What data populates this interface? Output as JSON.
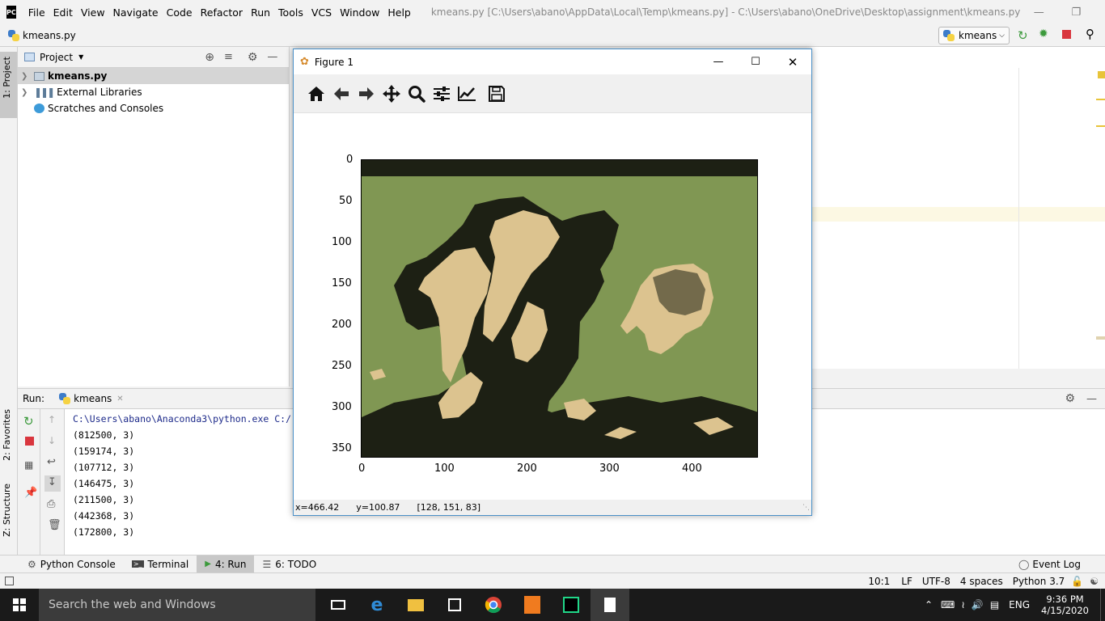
{
  "app": {
    "logo_text": "PC",
    "menu": [
      "File",
      "Edit",
      "View",
      "Navigate",
      "Code",
      "Refactor",
      "Run",
      "Tools",
      "VCS",
      "Window",
      "Help"
    ],
    "window_title": "kmeans.py [C:\\Users\\abano\\AppData\\Local\\Temp\\kmeans.py] - C:\\Users\\abano\\OneDrive\\Desktop\\assignment\\kmeans.py"
  },
  "navbar": {
    "file": "kmeans.py",
    "run_config": "kmeans"
  },
  "left_stripe": {
    "project_tab": "1: Project",
    "favorites_tab": "2: Favorites",
    "structure_tab": "Z: Structure"
  },
  "project": {
    "header": "Project",
    "items": [
      {
        "label": "kmeans.py"
      },
      {
        "label": "External Libraries"
      },
      {
        "label": "Scratches and Consoles"
      }
    ]
  },
  "run_panel": {
    "label": "Run:",
    "tab": "kmeans",
    "lines": [
      "C:\\Users\\abano\\Anaconda3\\python.exe C:/",
      "(812500, 3)",
      "(159174, 3)",
      "(107712, 3)",
      "(146475, 3)",
      "(211500, 3)",
      "(442368, 3)",
      "(172800, 3)"
    ]
  },
  "bottom_tabs": {
    "python_console": "Python Console",
    "terminal": "Terminal",
    "run": "4: Run",
    "todo": "6: TODO",
    "event_log": "Event Log"
  },
  "status": {
    "position": "10:1",
    "line_sep": "LF",
    "encoding": "UTF-8",
    "indent": "4 spaces",
    "interpreter": "Python 3.7"
  },
  "taskbar": {
    "search": "Search the web and Windows",
    "lang": "ENG",
    "time": "9:36 PM",
    "date": "4/15/2020"
  },
  "figure": {
    "title": "Figure 1",
    "status_x": "x=466.42",
    "status_y": "y=100.87",
    "status_rgb": "[128, 151, 83]",
    "y_ticks": [
      "0",
      "50",
      "100",
      "150",
      "200",
      "250",
      "300",
      "350"
    ],
    "x_ticks": [
      "0",
      "100",
      "200",
      "300",
      "400"
    ],
    "colors": {
      "green": "#809753",
      "dark": "#1d2014",
      "tan": "#dcc38f"
    }
  }
}
